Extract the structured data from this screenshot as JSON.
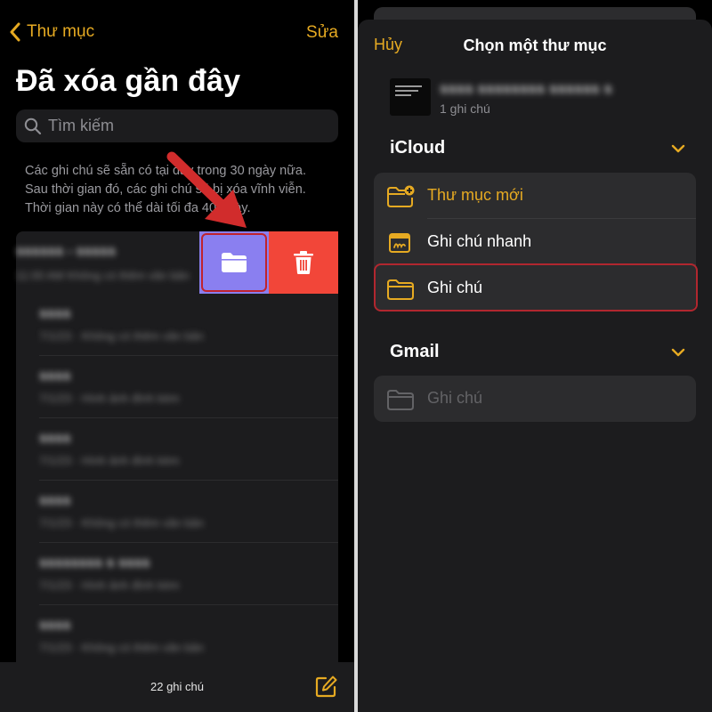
{
  "colors": {
    "accent": "#e6aa22",
    "move_button": "#8a7ff0",
    "delete_button": "#f24639",
    "annotation_red": "#d12c2c"
  },
  "left": {
    "nav": {
      "back_label": "Thư mục",
      "edit_label": "Sửa"
    },
    "title": "Đã xóa gần đây",
    "search": {
      "placeholder": "Tìm kiếm"
    },
    "info_lines": [
      "Các ghi chú sẽ sẵn có tại đây trong 30 ngày nữa.",
      "Sau thời gian đó, các ghi chú sẽ bị xóa vĩnh viễn.",
      "Thời gian này có thể dài tối đa 40 ngày."
    ],
    "swiped_note": {
      "title": "ssssss - sssss",
      "subtitle": "11:00 AM  Không có thêm văn bản"
    },
    "swipe_actions": {
      "move_icon": "folder-icon",
      "delete_icon": "trash-icon"
    },
    "notes": [
      {
        "title": "ssss",
        "subtitle": "7/1/23 · Không có thêm văn bản"
      },
      {
        "title": "ssss",
        "subtitle": "7/1/23 · Hình ảnh đính kèm"
      },
      {
        "title": "ssss",
        "subtitle": "7/1/23 · Hình ảnh đính kèm"
      },
      {
        "title": "ssss",
        "subtitle": "7/1/23 · Không có thêm văn bản"
      },
      {
        "title": "ssssssss s ssss",
        "subtitle": "7/1/23 · Hình ảnh đính kèm"
      },
      {
        "title": "ssss",
        "subtitle": "7/1/23 · Không có thêm văn bản"
      }
    ],
    "footer": {
      "count": "22 ghi chú",
      "compose_icon": "compose-icon"
    }
  },
  "right": {
    "cancel_label": "Hủy",
    "title": "Chọn một thư mục",
    "selected_note": {
      "title": "ssss ssssssss ssssss s",
      "count": "1 ghi chú"
    },
    "sections": [
      {
        "name": "iCloud",
        "folders": [
          {
            "label": "Thư mục mới",
            "icon": "new-folder-icon"
          },
          {
            "label": "Ghi chú nhanh",
            "icon": "quick-note-icon"
          },
          {
            "label": "Ghi chú",
            "icon": "folder-icon"
          }
        ]
      },
      {
        "name": "Gmail",
        "folders": [
          {
            "label": "Ghi chú",
            "icon": "folder-icon"
          }
        ]
      }
    ]
  }
}
